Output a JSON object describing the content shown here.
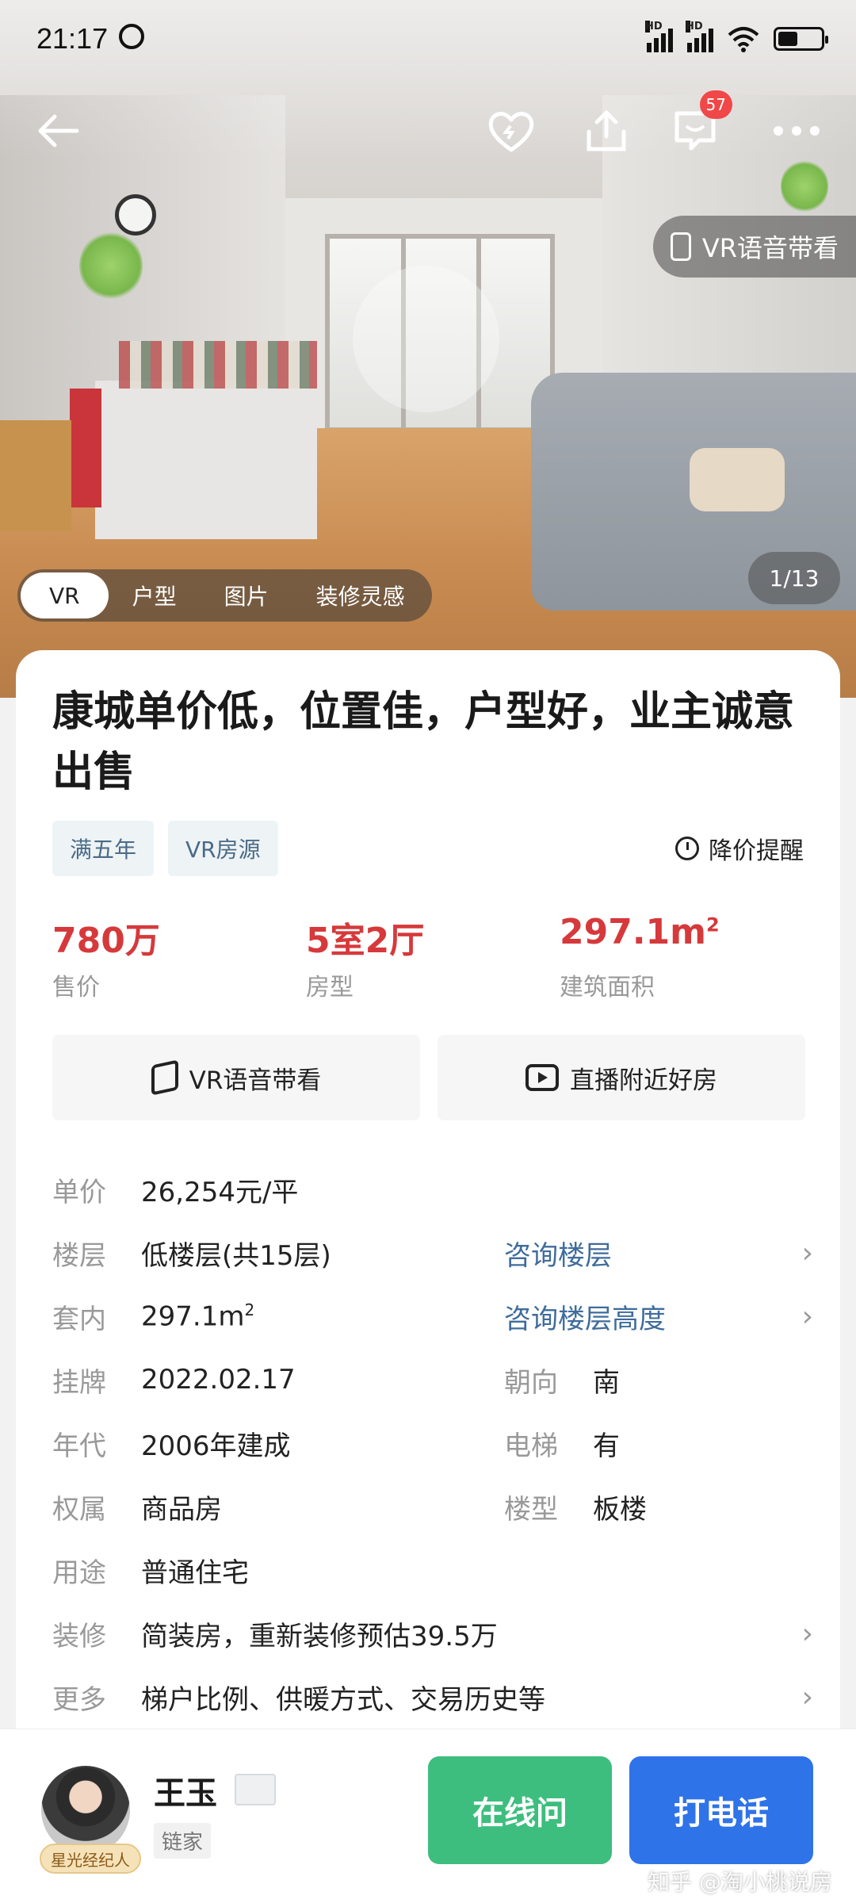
{
  "status": {
    "time": "21:17",
    "hd1": "HD",
    "hd2": "HD"
  },
  "hero": {
    "badge_count": "57",
    "vr_voice_label": "VR语音带看",
    "counter": "1/13",
    "tabs": [
      {
        "label": "VR"
      },
      {
        "label": "户型"
      },
      {
        "label": "图片"
      },
      {
        "label": "装修灵感"
      }
    ]
  },
  "listing": {
    "title": "康城单价低，位置佳，户型好，业主诚意出售",
    "tags": [
      "满五年",
      "VR房源"
    ],
    "price_alert": "降价提醒",
    "stats": [
      {
        "value": "780万",
        "label": "售价"
      },
      {
        "value": "5室2厅",
        "label": "房型"
      },
      {
        "value": "297.1m",
        "sup": "2",
        "label": "建筑面积"
      }
    ],
    "actions": {
      "vr": "VR语音带看",
      "live": "直播附近好房"
    },
    "details": {
      "unit_price": {
        "k": "单价",
        "v": "26,254元/平"
      },
      "floor": {
        "k": "楼层",
        "v": "低楼层(共15层)",
        "link": "咨询楼层"
      },
      "inner": {
        "k": "套内",
        "v": "297.1m",
        "sup": "2",
        "link": "咨询楼层高度"
      },
      "listed": {
        "k": "挂牌",
        "v": "2022.02.17",
        "k2": "朝向",
        "v2": "南"
      },
      "year": {
        "k": "年代",
        "v": "2006年建成",
        "k2": "电梯",
        "v2": "有"
      },
      "ownership": {
        "k": "权属",
        "v": "商品房",
        "k2": "楼型",
        "v2": "板楼"
      },
      "usage": {
        "k": "用途",
        "v": "普通住宅"
      },
      "decor": {
        "k": "装修",
        "v": "简装房，重新装修预估39.5万"
      },
      "more": {
        "k": "更多",
        "v": "梯户比例、供暖方式、交易历史等"
      }
    }
  },
  "agent": {
    "name": "王玉",
    "company": "链家",
    "badge": "星光经纪人"
  },
  "buttons": {
    "chat": "在线问",
    "call": "打电话"
  },
  "watermark": "知乎 @淘小桃说房",
  "colors": {
    "price_red": "#d6393b",
    "link_blue": "#3f6c9c",
    "chat_green": "#3dbe7e",
    "call_blue": "#2f73e8"
  }
}
